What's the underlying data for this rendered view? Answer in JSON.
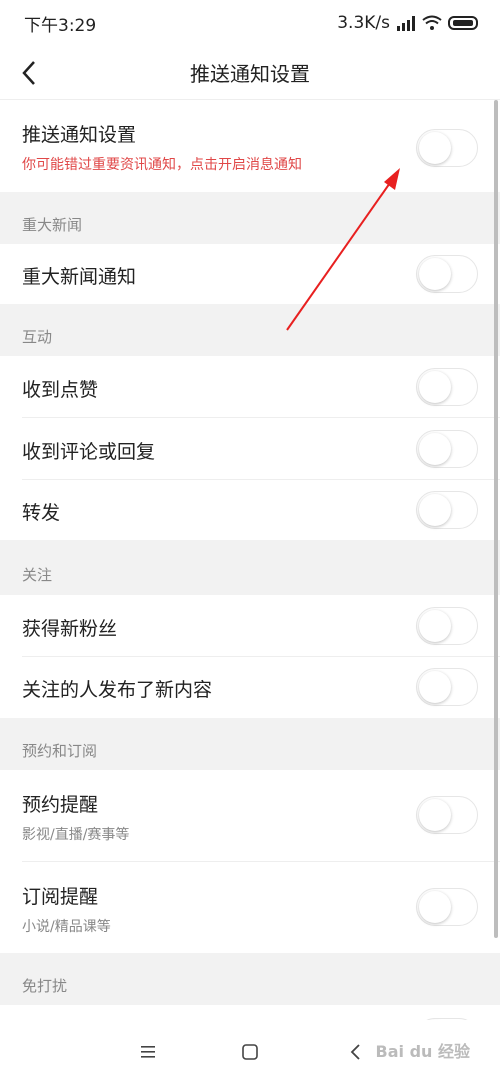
{
  "status_bar": {
    "time": "下午3:29",
    "speed": "3.3K/s"
  },
  "nav": {
    "title": "推送通知设置"
  },
  "master": {
    "label": "推送通知设置",
    "sub": "你可能错过重要资讯通知，点击开启消息通知"
  },
  "sections": {
    "major": {
      "title": "重大新闻",
      "items": [
        "重大新闻通知"
      ]
    },
    "interact": {
      "title": "互动",
      "items": [
        "收到点赞",
        "收到评论或回复",
        "转发"
      ]
    },
    "follow": {
      "title": "关注",
      "items": [
        "获得新粉丝",
        "关注的人发布了新内容"
      ]
    },
    "subscribe": {
      "title": "预约和订阅",
      "items": [
        {
          "label": "预约提醒",
          "sub": "影视/直播/赛事等"
        },
        {
          "label": "订阅提醒",
          "sub": "小说/精品课等"
        }
      ]
    },
    "dnd": {
      "title": "免打扰"
    }
  },
  "watermark": "Bai du 经验",
  "colors": {
    "hint_red": "#e04848",
    "arrow_red": "#e82020"
  }
}
